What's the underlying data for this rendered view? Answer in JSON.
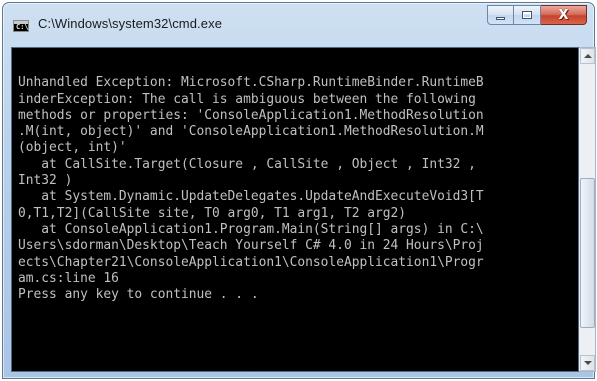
{
  "window": {
    "title": "C:\\Windows\\system32\\cmd.exe",
    "icon": "cmd-console-icon",
    "icon_text": "C:\\",
    "controls": {
      "minimize": "minimize-icon",
      "maximize": "maximize-icon",
      "close_glyph": "X"
    }
  },
  "console": {
    "background": "#000000",
    "foreground": "#c0c0c0",
    "lines": [
      "",
      "Unhandled Exception: Microsoft.CSharp.RuntimeBinder.RuntimeB",
      "inderException: The call is ambiguous between the following",
      "methods or properties: 'ConsoleApplication1.MethodResolution",
      ".M(int, object)' and 'ConsoleApplication1.MethodResolution.M",
      "(object, int)'",
      "   at CallSite.Target(Closure , CallSite , Object , Int32 ,",
      "Int32 )",
      "   at System.Dynamic.UpdateDelegates.UpdateAndExecuteVoid3[T",
      "0,T1,T2](CallSite site, T0 arg0, T1 arg1, T2 arg2)",
      "   at ConsoleApplication1.Program.Main(String[] args) in C:\\",
      "Users\\sdorman\\Desktop\\Teach Yourself C# 4.0 in 24 Hours\\Proj",
      "ects\\Chapter21\\ConsoleApplication1\\ConsoleApplication1\\Progr",
      "am.cs:line 16",
      "Press any key to continue . . ."
    ]
  }
}
